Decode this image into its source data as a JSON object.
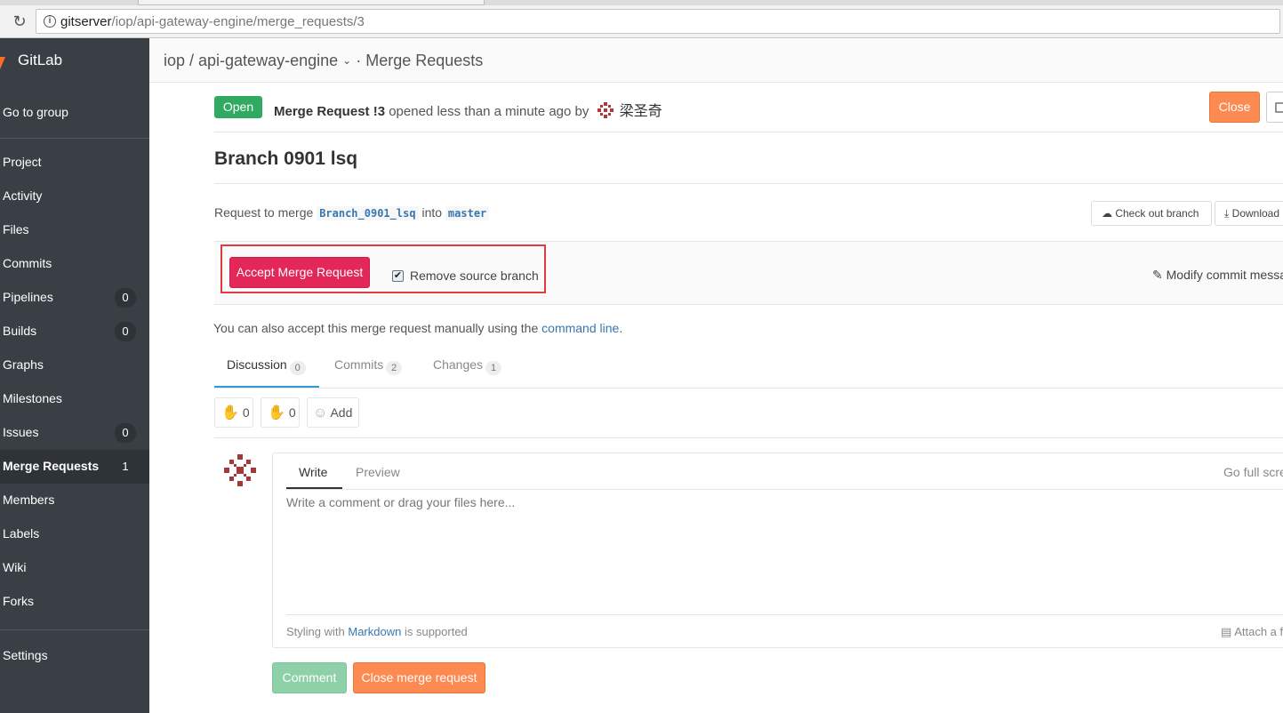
{
  "browser": {
    "url_host": "gitserver",
    "url_path": "/iop/api-gateway-engine/merge_requests/3"
  },
  "sidebar": {
    "brand": "GitLab",
    "go_to_group": "Go to group",
    "items": [
      {
        "label": "Project",
        "count": null
      },
      {
        "label": "Activity",
        "count": null
      },
      {
        "label": "Files",
        "count": null
      },
      {
        "label": "Commits",
        "count": null
      },
      {
        "label": "Pipelines",
        "count": "0"
      },
      {
        "label": "Builds",
        "count": "0"
      },
      {
        "label": "Graphs",
        "count": null
      },
      {
        "label": "Milestones",
        "count": null
      },
      {
        "label": "Issues",
        "count": "0"
      },
      {
        "label": "Merge Requests",
        "count": "1"
      },
      {
        "label": "Members",
        "count": null
      },
      {
        "label": "Labels",
        "count": null
      },
      {
        "label": "Wiki",
        "count": null
      },
      {
        "label": "Forks",
        "count": null
      }
    ],
    "settings": "Settings",
    "active_item": "Merge Requests"
  },
  "header": {
    "breadcrumb_project": "iop / api-gateway-engine",
    "breadcrumb_section": "· Merge Requests"
  },
  "mr": {
    "status": "Open",
    "ref": "Merge Request !3",
    "opened_text": "opened less than a minute ago by",
    "author": "梁圣奇",
    "close_button": "Close",
    "title": "Branch 0901 lsq",
    "request_prefix": "Request to merge",
    "source_branch": "Branch_0901_lsq",
    "into": "into",
    "target_branch": "master",
    "checkout_button": "Check out branch",
    "download_button": "Download"
  },
  "merge_widget": {
    "accept_button": "Accept Merge Request",
    "remove_source_label": "Remove source branch",
    "remove_source_checked": true,
    "modify_commit": "Modify commit message"
  },
  "manual": {
    "text": "You can also accept this merge request manually using the",
    "link": "command line",
    "end": "."
  },
  "tabs": [
    {
      "label": "Discussion",
      "count": "0"
    },
    {
      "label": "Commits",
      "count": "2"
    },
    {
      "label": "Changes",
      "count": "1"
    }
  ],
  "awards": {
    "thumbs_up": "0",
    "thumbs_down": "0",
    "add": "Add"
  },
  "note_form": {
    "tab_write": "Write",
    "tab_preview": "Preview",
    "fullscreen": "Go full screen",
    "placeholder": "Write a comment or drag your files here...",
    "md_prefix": "Styling with",
    "md_link": "Markdown",
    "md_suffix": "is supported",
    "attach": "Attach a file",
    "comment_button": "Comment",
    "close_mr_button": "Close merge request"
  },
  "colors": {
    "sidebar": "#393f44",
    "open_badge": "#2faa60",
    "close_orange": "#fc8a51",
    "accept_red": "#e32759",
    "highlight_outline": "#e0393e",
    "link_blue": "#3777b0"
  }
}
